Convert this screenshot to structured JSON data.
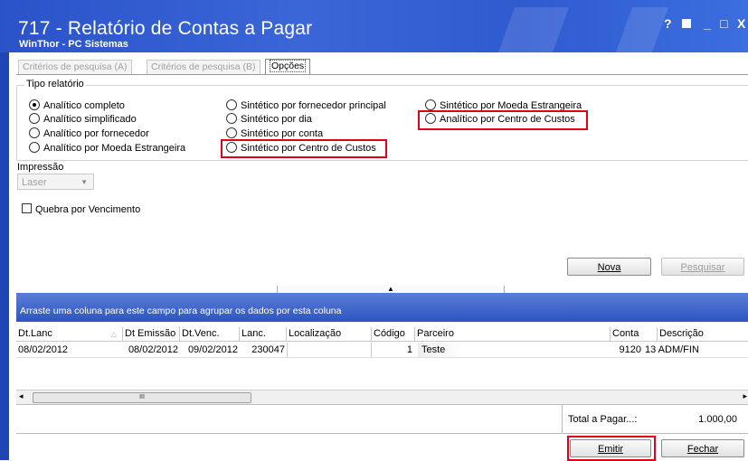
{
  "window": {
    "title": "717 - Relatório de Contas a Pagar",
    "subtitle": "WinThor - PC Sistemas",
    "help_btn": "?",
    "minimize_btn": "_",
    "maximize_btn": "□",
    "close_btn": "X"
  },
  "tabs": [
    {
      "label": "Critérios de pesquisa (A)"
    },
    {
      "label": "Critérios de pesquisa (B)"
    },
    {
      "label": "Opções"
    }
  ],
  "report_type": {
    "group_label": "Tipo relatório",
    "options": [
      {
        "label": "Analítico completo",
        "selected": true
      },
      {
        "label": "Analítico simplificado",
        "selected": false
      },
      {
        "label": "Analítico por fornecedor",
        "selected": false
      },
      {
        "label": "Analítico por Moeda Estrangeira",
        "selected": false
      },
      {
        "label": "Sintético por fornecedor principal",
        "selected": false
      },
      {
        "label": "Sintético por dia",
        "selected": false
      },
      {
        "label": "Sintético por conta",
        "selected": false
      },
      {
        "label": "Sintético por Centro de Custos",
        "selected": false
      },
      {
        "label": "Sintético por Moeda Estrangeira",
        "selected": false
      },
      {
        "label": "Analítico por Centro de Custos",
        "selected": false
      }
    ]
  },
  "printing": {
    "label": "Impressão",
    "value": "Laser"
  },
  "break_by_due": {
    "label": "Quebra por Vencimento",
    "checked": false
  },
  "buttons": {
    "nova": "Nova",
    "pesquisar": "Pesquisar",
    "emitir": "Emitir",
    "fechar": "Fechar"
  },
  "grid": {
    "group_hint": "Arraste uma coluna para este campo para agrupar os dados por esta coluna",
    "columns": [
      "Dt.Lanc",
      "Dt Emissão",
      "Dt.Venc.",
      "Lanc.",
      "Localização",
      "Código",
      "Parceiro",
      "Conta",
      "Descrição"
    ],
    "rows": [
      {
        "dt_lanc": "08/02/2012",
        "dt_emissao": "08/02/2012",
        "dt_venc": "09/02/2012",
        "lanc": "230047",
        "localizacao": "",
        "codigo": "1",
        "parceiro": "Teste",
        "conta": "9120",
        "descricao": "13 ADM/FIN"
      }
    ],
    "scroll_thumb": "III"
  },
  "total": {
    "label": "Total a Pagar...:",
    "value": "1.000,00"
  },
  "colors": {
    "titlebar": "#2a53c9",
    "highlight": "#e0001a",
    "group_header": "#2e54c2"
  }
}
